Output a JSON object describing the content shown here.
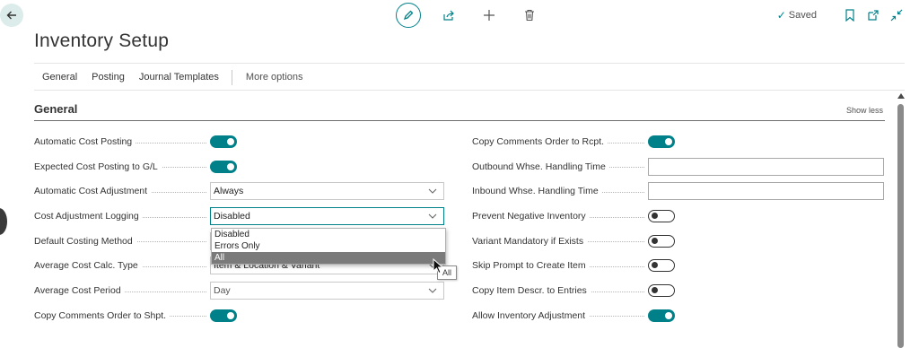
{
  "nav": {
    "back_icon": "arrow-left-icon"
  },
  "toolbar": {
    "edit_icon": "pencil-icon",
    "share_icon": "share-icon",
    "new_icon": "plus-icon",
    "delete_icon": "trash-icon",
    "saved_label": "Saved",
    "bookmark_icon": "bookmark-icon",
    "open_new_window_icon": "open-in-new-window-icon",
    "collapse_icon": "collapse-icon"
  },
  "page": {
    "title": "Inventory Setup"
  },
  "tabs": {
    "items": [
      "General",
      "Posting",
      "Journal Templates"
    ],
    "more": "More options"
  },
  "section": {
    "title": "General",
    "show_less": "Show less"
  },
  "left_fields": [
    {
      "label": "Automatic Cost Posting",
      "type": "toggle",
      "on": true
    },
    {
      "label": "Expected Cost Posting to G/L",
      "type": "toggle",
      "on": true
    },
    {
      "label": "Automatic Cost Adjustment",
      "type": "select",
      "value": "Always"
    },
    {
      "label": "Cost Adjustment Logging",
      "type": "select",
      "value": "Disabled"
    },
    {
      "label": "Default Costing Method",
      "type": "select",
      "value": ""
    },
    {
      "label": "Average Cost Calc. Type",
      "type": "select",
      "value": "Item & Location & Variant"
    },
    {
      "label": "Average Cost Period",
      "type": "select",
      "value": "Day"
    },
    {
      "label": "Copy Comments Order to Shpt.",
      "type": "toggle",
      "on": true
    }
  ],
  "right_fields": [
    {
      "label": "Copy Comments Order to Rcpt.",
      "type": "toggle",
      "on": true
    },
    {
      "label": "Outbound Whse. Handling Time",
      "type": "text",
      "value": ""
    },
    {
      "label": "Inbound Whse. Handling Time",
      "type": "text",
      "value": ""
    },
    {
      "label": "Prevent Negative Inventory",
      "type": "toggle",
      "on": false
    },
    {
      "label": "Variant Mandatory if Exists",
      "type": "toggle",
      "on": false
    },
    {
      "label": "Skip Prompt to Create Item",
      "type": "toggle",
      "on": false
    },
    {
      "label": "Copy Item Descr. to Entries",
      "type": "toggle",
      "on": false
    },
    {
      "label": "Allow Inventory Adjustment",
      "type": "toggle",
      "on": true
    }
  ],
  "dropdown": {
    "options": [
      "Disabled",
      "Errors Only",
      "All"
    ],
    "highlighted": "All"
  },
  "tooltip": {
    "text": "All"
  },
  "colors": {
    "accent": "#00818a",
    "highlight": "#7a7a7a"
  }
}
